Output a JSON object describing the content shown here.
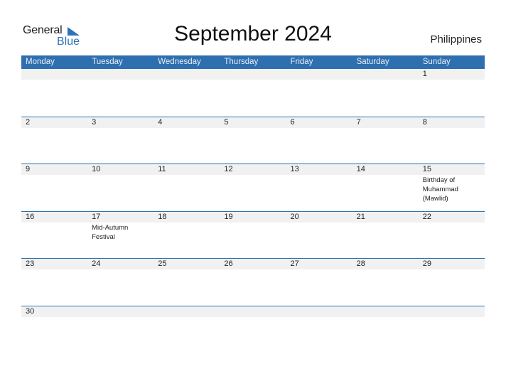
{
  "logo": {
    "part1": "General",
    "part2": "Blue"
  },
  "title": "September 2024",
  "country": "Philippines",
  "colors": {
    "header_bg": "#2e6fb0",
    "date_band": "#f1f1f1",
    "accent": "#2e73b8"
  },
  "weekdays": [
    "Monday",
    "Tuesday",
    "Wednesday",
    "Thursday",
    "Friday",
    "Saturday",
    "Sunday"
  ],
  "weeks": [
    [
      {
        "day": ""
      },
      {
        "day": ""
      },
      {
        "day": ""
      },
      {
        "day": ""
      },
      {
        "day": ""
      },
      {
        "day": ""
      },
      {
        "day": "1"
      }
    ],
    [
      {
        "day": "2"
      },
      {
        "day": "3"
      },
      {
        "day": "4"
      },
      {
        "day": "5"
      },
      {
        "day": "6"
      },
      {
        "day": "7"
      },
      {
        "day": "8"
      }
    ],
    [
      {
        "day": "9"
      },
      {
        "day": "10"
      },
      {
        "day": "11"
      },
      {
        "day": "12"
      },
      {
        "day": "13"
      },
      {
        "day": "14"
      },
      {
        "day": "15",
        "holiday": "Birthday of Muhammad (Mawlid)"
      }
    ],
    [
      {
        "day": "16"
      },
      {
        "day": "17",
        "holiday": "Mid-Autumn Festival"
      },
      {
        "day": "18"
      },
      {
        "day": "19"
      },
      {
        "day": "20"
      },
      {
        "day": "21"
      },
      {
        "day": "22"
      }
    ],
    [
      {
        "day": "23"
      },
      {
        "day": "24"
      },
      {
        "day": "25"
      },
      {
        "day": "26"
      },
      {
        "day": "27"
      },
      {
        "day": "28"
      },
      {
        "day": "29"
      }
    ],
    [
      {
        "day": "30"
      },
      {
        "day": ""
      },
      {
        "day": ""
      },
      {
        "day": ""
      },
      {
        "day": ""
      },
      {
        "day": ""
      },
      {
        "day": ""
      }
    ]
  ]
}
